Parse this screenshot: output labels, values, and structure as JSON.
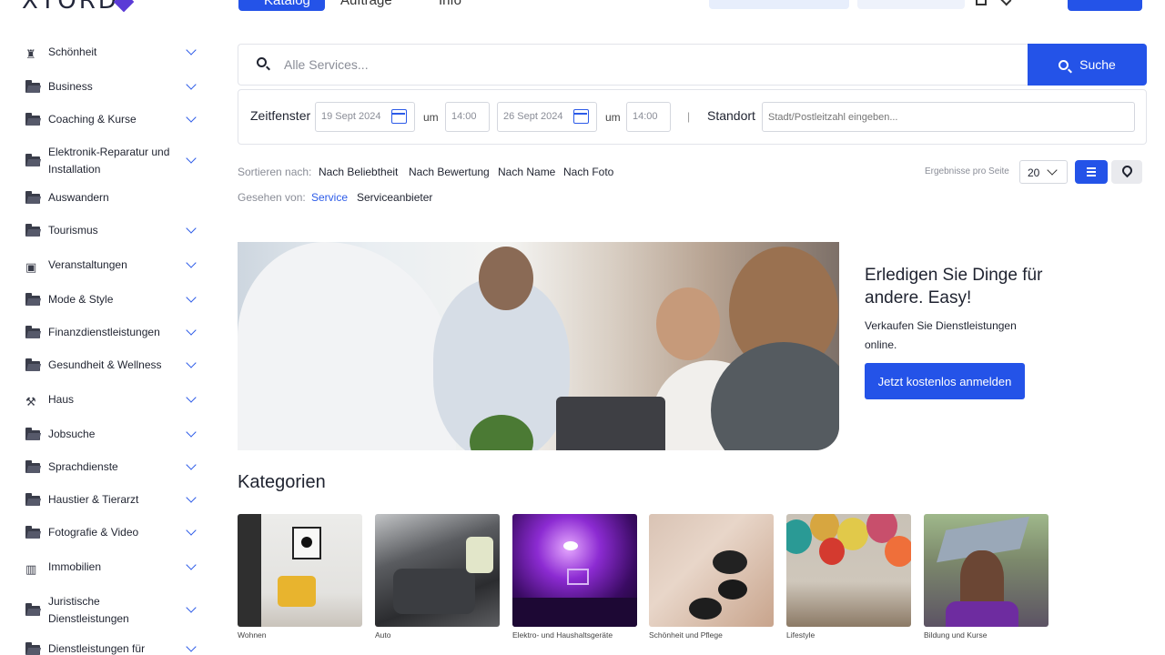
{
  "header": {
    "logo_text": "XTORD",
    "nav": {
      "katalog": "Katalog",
      "auftraege": "Aufträge",
      "info": "Info"
    }
  },
  "sidebar": {
    "items": [
      {
        "label": "Schönheit",
        "icon": "beauty-bottles-icon",
        "chevron": true
      },
      {
        "label": "Business",
        "icon": "folder-icon",
        "chevron": true
      },
      {
        "label": "Coaching & Kurse",
        "icon": "folder-icon",
        "chevron": true
      },
      {
        "label": "Elektronik-Reparatur und Installation",
        "icon": "folder-icon",
        "chevron": true
      },
      {
        "label": "Auswandern",
        "icon": "folder-icon",
        "chevron": false
      },
      {
        "label": "Tourismus",
        "icon": "folder-icon",
        "chevron": true
      },
      {
        "label": "Veranstaltungen",
        "icon": "calendar-icon",
        "chevron": true
      },
      {
        "label": "Mode & Style",
        "icon": "folder-icon",
        "chevron": true
      },
      {
        "label": "Finanzdienstleistungen",
        "icon": "folder-icon",
        "chevron": true
      },
      {
        "label": "Gesundheit & Wellness",
        "icon": "folder-icon",
        "chevron": true
      },
      {
        "label": "Haus",
        "icon": "wrench-icon",
        "chevron": true
      },
      {
        "label": "Jobsuche",
        "icon": "folder-icon",
        "chevron": true
      },
      {
        "label": "Sprachdienste",
        "icon": "folder-icon",
        "chevron": true
      },
      {
        "label": "Haustier & Tierarzt",
        "icon": "folder-icon",
        "chevron": true
      },
      {
        "label": "Fotografie & Video",
        "icon": "folder-icon",
        "chevron": true
      },
      {
        "label": "Immobilien",
        "icon": "building-icon",
        "chevron": true
      },
      {
        "label": "Juristische Dienstleistungen",
        "icon": "folder-icon",
        "chevron": true
      },
      {
        "label": "Dienstleistungen für",
        "icon": "folder-icon",
        "chevron": true
      }
    ]
  },
  "search": {
    "placeholder": "Alle Services...",
    "button_label": "Suche"
  },
  "filters": {
    "zeitfenster_label": "Zeitfenster",
    "date_from": "19 Sept 2024",
    "um1": "um",
    "time_from": "14:00",
    "date_to": "26 Sept 2024",
    "um2": "um",
    "time_to": "14:00",
    "separator": "|",
    "standort_label": "Standort",
    "standort_placeholder": "Stadt/Postleitzahl eingeben..."
  },
  "sort": {
    "label": "Sortieren nach:",
    "options": [
      "Nach Beliebtheit",
      "Nach Bewertung",
      "Nach Name",
      "Nach Foto"
    ],
    "seen_label": "Gesehen von:",
    "seen_options": [
      "Service",
      "Serviceanbieter"
    ],
    "seen_active": "Service",
    "per_page_label": "Ergebnisse pro Seite",
    "per_page_value": "20"
  },
  "hero": {
    "title": "Erledigen Sie Dinge für andere. Easy!",
    "text": "Verkaufen Sie Dienstleistungen online.",
    "button_label": "Jetzt kostenlos anmelden"
  },
  "categories": {
    "title": "Kategorien",
    "items": [
      {
        "label": "Wohnen"
      },
      {
        "label": "Auto"
      },
      {
        "label": "Elektro- und Haushaltsgeräte"
      },
      {
        "label": "Schönheit und Pflege"
      },
      {
        "label": "Lifestyle"
      },
      {
        "label": "Bildung und Kurse"
      }
    ]
  },
  "colors": {
    "accent": "#2453e8",
    "link": "#2c5be8",
    "muted": "#8a8d97"
  }
}
